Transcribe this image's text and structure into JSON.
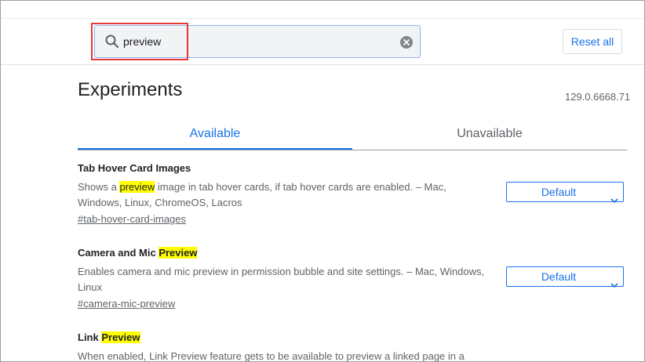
{
  "search": {
    "value": "preview",
    "clear_icon": "clear-icon",
    "search_icon": "search-icon",
    "reset_label": "Reset all"
  },
  "page": {
    "title": "Experiments",
    "version": "129.0.6668.71"
  },
  "tabs": [
    {
      "label": "Available",
      "active": true
    },
    {
      "label": "Unavailable",
      "active": false
    }
  ],
  "experiments": [
    {
      "title_pre": "Tab Hover Card Images",
      "title_hl": "",
      "desc_pre": "Shows a ",
      "desc_hl": "preview",
      "desc_post": " image in tab hover cards, if tab hover cards are enabled. – Mac, Windows, Linux, ChromeOS, Lacros",
      "link": "#tab-hover-card-images",
      "select_value": "Default"
    },
    {
      "title_pre": "Camera and Mic ",
      "title_hl": "Preview",
      "desc_pre": "Enables camera and mic preview in permission bubble and site settings. – Mac, Windows, Linux",
      "desc_hl": "",
      "desc_post": "",
      "link": "#camera-mic-preview",
      "select_value": "Default"
    },
    {
      "title_pre": "Link ",
      "title_hl": "Preview",
      "desc_pre": "When enabled, Link Preview feature gets to be available to preview a linked page in a",
      "desc_hl": "",
      "desc_post": ""
    }
  ],
  "colors": {
    "accent": "#1a73e8",
    "highlight": "#ffff00",
    "focus_outline": "#e53935"
  }
}
